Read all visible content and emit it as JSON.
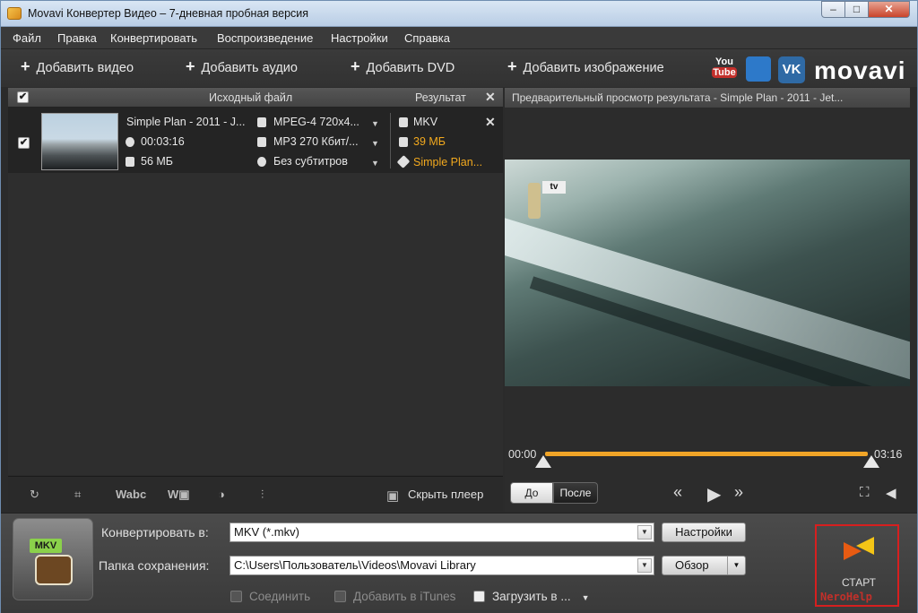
{
  "window": {
    "title": "Movavi Конвертер Видео – 7-дневная пробная версия",
    "min": "–",
    "max": "□",
    "close": "✕"
  },
  "menu": [
    "Файл",
    "Правка",
    "Конвертировать",
    "Воспроизведение",
    "Настройки",
    "Справка"
  ],
  "toolbar": {
    "add_video": "Добавить видео",
    "add_audio": "Добавить аудио",
    "add_dvd": "Добавить DVD",
    "add_image": "Добавить изображение",
    "youtube_top": "You",
    "youtube_bottom": "Tube",
    "vk": "VK",
    "logo": "movavi"
  },
  "list": {
    "header_source": "Исходный файл",
    "header_result": "Результат",
    "rows": [
      {
        "checked": "✔",
        "name": "Simple Plan - 2011 - J...",
        "duration": "00:03:16",
        "size": "56 МБ",
        "video": "MPEG-4 720x4...",
        "audio": "MP3 270 Кбит/...",
        "subtitles": "Без субтитров",
        "result_format": "MKV",
        "result_size": "39 МБ",
        "result_name": "Simple Plan..."
      }
    ]
  },
  "tools": {
    "hide_player": "Скрыть плеер"
  },
  "preview": {
    "header": "Предварительный просмотр результата - Simple Plan - 2011 - Jet...",
    "time_start": "00:00",
    "time_end": "03:16",
    "before": "До",
    "after": "После",
    "overlay_tv": "tv"
  },
  "footer": {
    "format_tag": "MKV",
    "convert_to_label": "Конвертировать в:",
    "convert_to_value": "MKV (*.mkv)",
    "settings_button": "Настройки",
    "folder_label": "Папка сохранения:",
    "folder_value": "C:\\Users\\Пользователь\\Videos\\Movavi Library",
    "browse_button": "Обзор",
    "join": "Соединить",
    "itunes": "Добавить в iTunes",
    "upload": "Загрузить в ...",
    "start": "СТАРТ",
    "watermark": "NeroHelp"
  }
}
